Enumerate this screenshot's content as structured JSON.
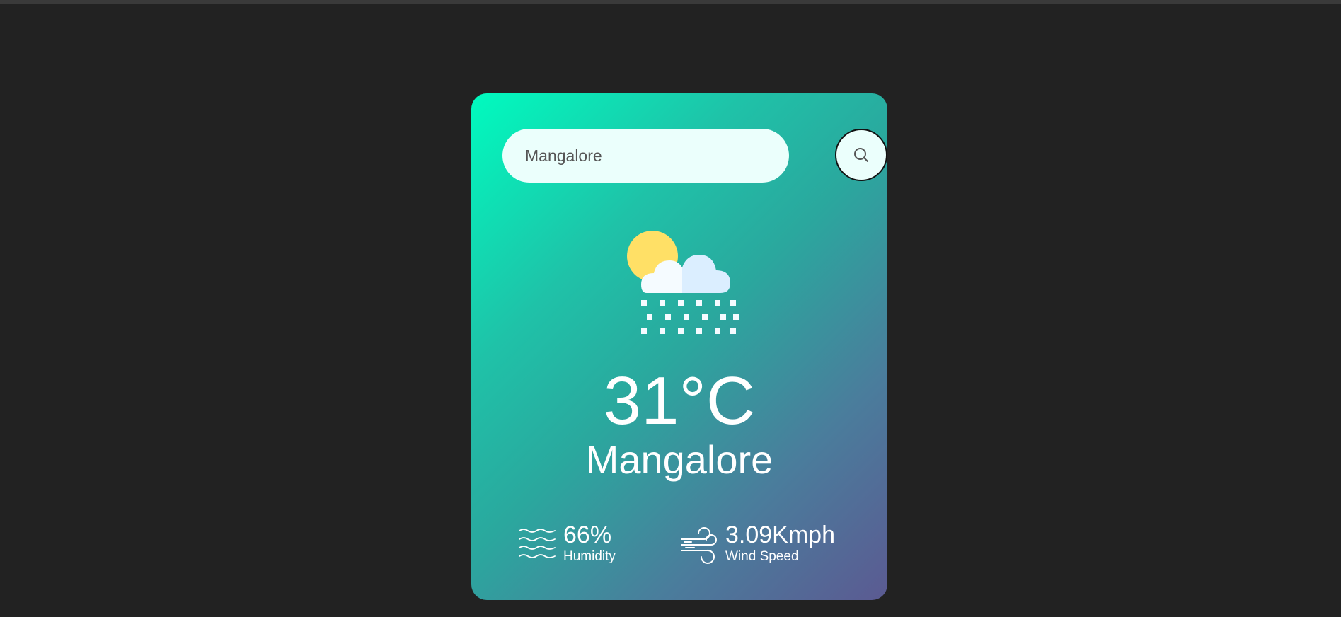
{
  "search": {
    "value": "Mangalore",
    "button_icon": "search-icon"
  },
  "weather": {
    "icon": "snow-cloud-sun-icon",
    "temperature": "31°C",
    "city": "Mangalore"
  },
  "details": {
    "humidity": {
      "icon": "humidity-waves-icon",
      "value": "66%",
      "label": "Humidity"
    },
    "wind": {
      "icon": "wind-icon",
      "value": "3.09Kmph",
      "label": "Wind Speed"
    }
  },
  "colors": {
    "background": "#222222",
    "card_gradient_start": "#00fbbf",
    "card_gradient_end": "#5b5a92",
    "input_bg": "#ebfffc",
    "text": "#ffffff"
  }
}
